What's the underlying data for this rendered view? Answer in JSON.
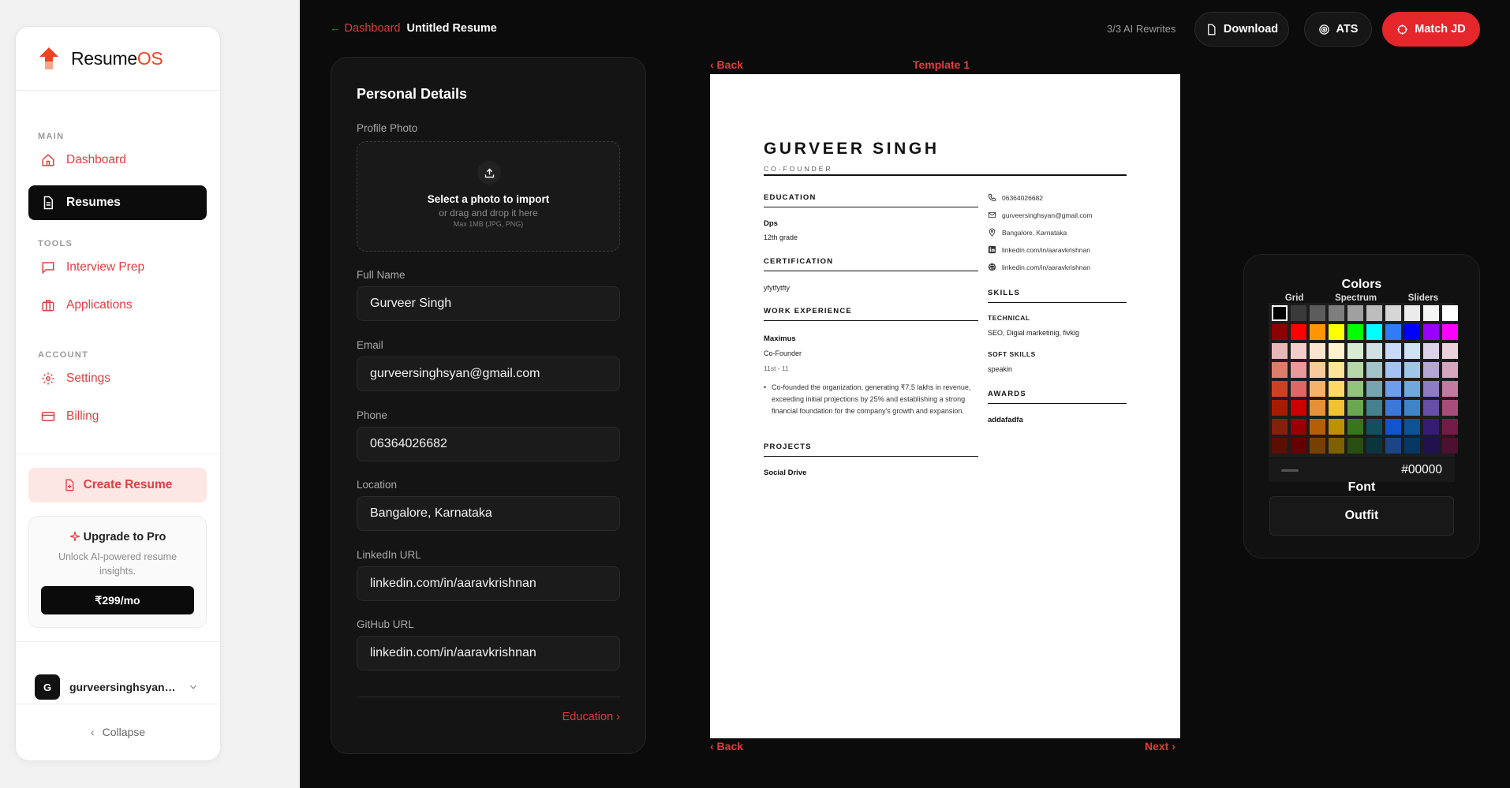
{
  "sidebar": {
    "brand": {
      "name_main": "Resume",
      "name_accent": "OS"
    },
    "sections": {
      "main": "MAIN",
      "tools": "TOOLS",
      "account": "ACCOUNT"
    },
    "items": [
      {
        "label": "Dashboard",
        "icon": "home-icon"
      },
      {
        "label": "Resumes",
        "icon": "document-icon",
        "active": true
      },
      {
        "label": "Interview Prep",
        "icon": "chat-icon"
      },
      {
        "label": "Applications",
        "icon": "briefcase-icon"
      },
      {
        "label": "Settings",
        "icon": "gear-icon"
      },
      {
        "label": "Billing",
        "icon": "credit-card-icon"
      }
    ],
    "create_label": "Create Resume",
    "upgrade": {
      "title": "Upgrade to Pro",
      "desc": "Unlock AI-powered resume insights.",
      "price": "₹299/mo"
    },
    "user": {
      "initial": "G",
      "name": "gurveersinghsyan1..."
    },
    "collapse_label": "Collapse"
  },
  "topbar": {
    "back_label": "← Dashboard",
    "doc_title": "Untitled Resume",
    "rewrites": "3/3 AI Rewrites",
    "download_label": "Download",
    "ats_label": "ATS",
    "match_label": "Match JD"
  },
  "form": {
    "title": "Personal Details",
    "photo_label": "Profile Photo",
    "upload_title": "Select a photo to import",
    "upload_sub": "or drag and drop it here",
    "upload_max": "Max 1MB (JPG, PNG)",
    "fields": [
      {
        "label": "Full Name",
        "value": "Gurveer Singh"
      },
      {
        "label": "Email",
        "value": "gurveersinghsyan@gmail.com"
      },
      {
        "label": "Phone",
        "value": "06364026682"
      },
      {
        "label": "Location",
        "value": "Bangalore, Karnataka"
      },
      {
        "label": "LinkedIn URL",
        "value": "linkedin.com/in/aaravkrishnan"
      },
      {
        "label": "GitHub URL",
        "value": "linkedin.com/in/aaravkrishnan"
      }
    ],
    "next_label": "Education ›"
  },
  "preview": {
    "back_top": "‹ Back",
    "template": "Template 1",
    "back_bottom": "‹ Back",
    "next_bottom": "Next ›",
    "resume": {
      "name": "GURVEER SINGH",
      "role": "CO-FOUNDER",
      "education_h": "EDUCATION",
      "edu_school": "Dps",
      "edu_grade": "12th grade",
      "cert_h": "CERTIFICATION",
      "cert_item": "yfytfytfty",
      "work_h": "WORK EXPERIENCE",
      "work_company": "Maximus",
      "work_role": "Co-Founder",
      "work_dates": "11st - 11",
      "work_bullet": "Co-founded the organization, generating ₹7.5 lakhs in revenue, exceeding initial projections by 25% and establishing a strong financial foundation for the company's growth and expansion.",
      "projects_h": "PROJECTS",
      "project_item": "Social Drive",
      "contact": {
        "phone": "06364026682",
        "email": "gurveersinghsyan@gmail.com",
        "location": "Bangalore, Karnataka",
        "linkedin": "linkedin.com/in/aaravkrishnan",
        "github": "linkedin.com/in/aaravkrishnan"
      },
      "skills_h": "SKILLS",
      "tech_h": "TECHNICAL",
      "tech_v": "SEO, Digial marketinig, fivkig",
      "soft_h": "SOFT SKILLS",
      "soft_v": "speakin",
      "awards_h": "AWARDS",
      "award_item": "addafadfa"
    }
  },
  "picker": {
    "title": "Colors",
    "tabs": [
      "Grid",
      "Spectrum",
      "Sliders"
    ],
    "hex": "#00000",
    "font_title": "Font",
    "font_value": "Outfit",
    "rows": [
      [
        "#000000",
        "#3a3a3a",
        "#5c5c5c",
        "#7e7e7e",
        "#a0a0a0",
        "#bdbdbd",
        "#d6d6d6",
        "#ebebeb",
        "#f5f5f5",
        "#ffffff"
      ],
      [
        "#8b0000",
        "#ff0000",
        "#ff9500",
        "#ffff00",
        "#00ff00",
        "#00ffff",
        "#2f7cf6",
        "#0000ff",
        "#9900ff",
        "#ff00ff"
      ],
      [
        "#e6b8b7",
        "#f4cccc",
        "#fce5cd",
        "#fff2cc",
        "#d9ead3",
        "#d0e0e3",
        "#c9daf8",
        "#cfe2f3",
        "#d9d2e9",
        "#ead1dc"
      ],
      [
        "#dd7e6b",
        "#ea9999",
        "#f9cb9c",
        "#ffe599",
        "#b6d7a8",
        "#a2c4c9",
        "#a4c2f4",
        "#9fc5e8",
        "#b4a7d6",
        "#d5a6bd"
      ],
      [
        "#cc4125",
        "#e06666",
        "#f6b26b",
        "#ffd966",
        "#93c47d",
        "#76a5af",
        "#6d9eeb",
        "#6fa8dc",
        "#8e7cc3",
        "#c27ba0"
      ],
      [
        "#a61c00",
        "#cc0000",
        "#e69138",
        "#f1c232",
        "#6aa84f",
        "#45818e",
        "#3c78d8",
        "#3d85c6",
        "#674ea7",
        "#a64d79"
      ],
      [
        "#85200c",
        "#990000",
        "#b45f06",
        "#bf9000",
        "#38761d",
        "#134f5c",
        "#1155cc",
        "#0b5394",
        "#351c75",
        "#741b47"
      ],
      [
        "#5b0f00",
        "#660000",
        "#783f04",
        "#7f6000",
        "#274e13",
        "#0c343d",
        "#1c4587",
        "#073763",
        "#20124d",
        "#4c1130"
      ]
    ]
  }
}
